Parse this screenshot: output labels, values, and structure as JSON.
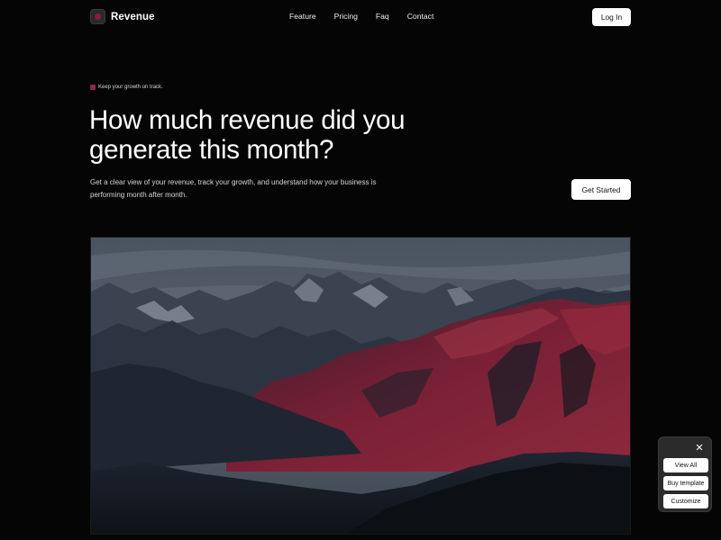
{
  "brand": {
    "name": "Revenue"
  },
  "nav": {
    "links": [
      "Feature",
      "Pricing",
      "Faq",
      "Contact"
    ],
    "login_label": "Log In"
  },
  "hero": {
    "tagline": "Keep your growth on track.",
    "headline_line1": "How much revenue did you",
    "headline_line2": "generate this month?",
    "subtext": "Get a clear view of your revenue, track your growth, and understand how your business is performing month after month.",
    "cta_label": "Get Started"
  },
  "float_panel": {
    "view_all_label": "View All",
    "buy_template_label": "Buy template",
    "customize_label": "Customize"
  },
  "colors": {
    "background": "#050505",
    "accent": "#8c2a48",
    "button_bg": "#ffffff",
    "button_text": "#111111",
    "panel_bg": "#2b2b2b"
  }
}
